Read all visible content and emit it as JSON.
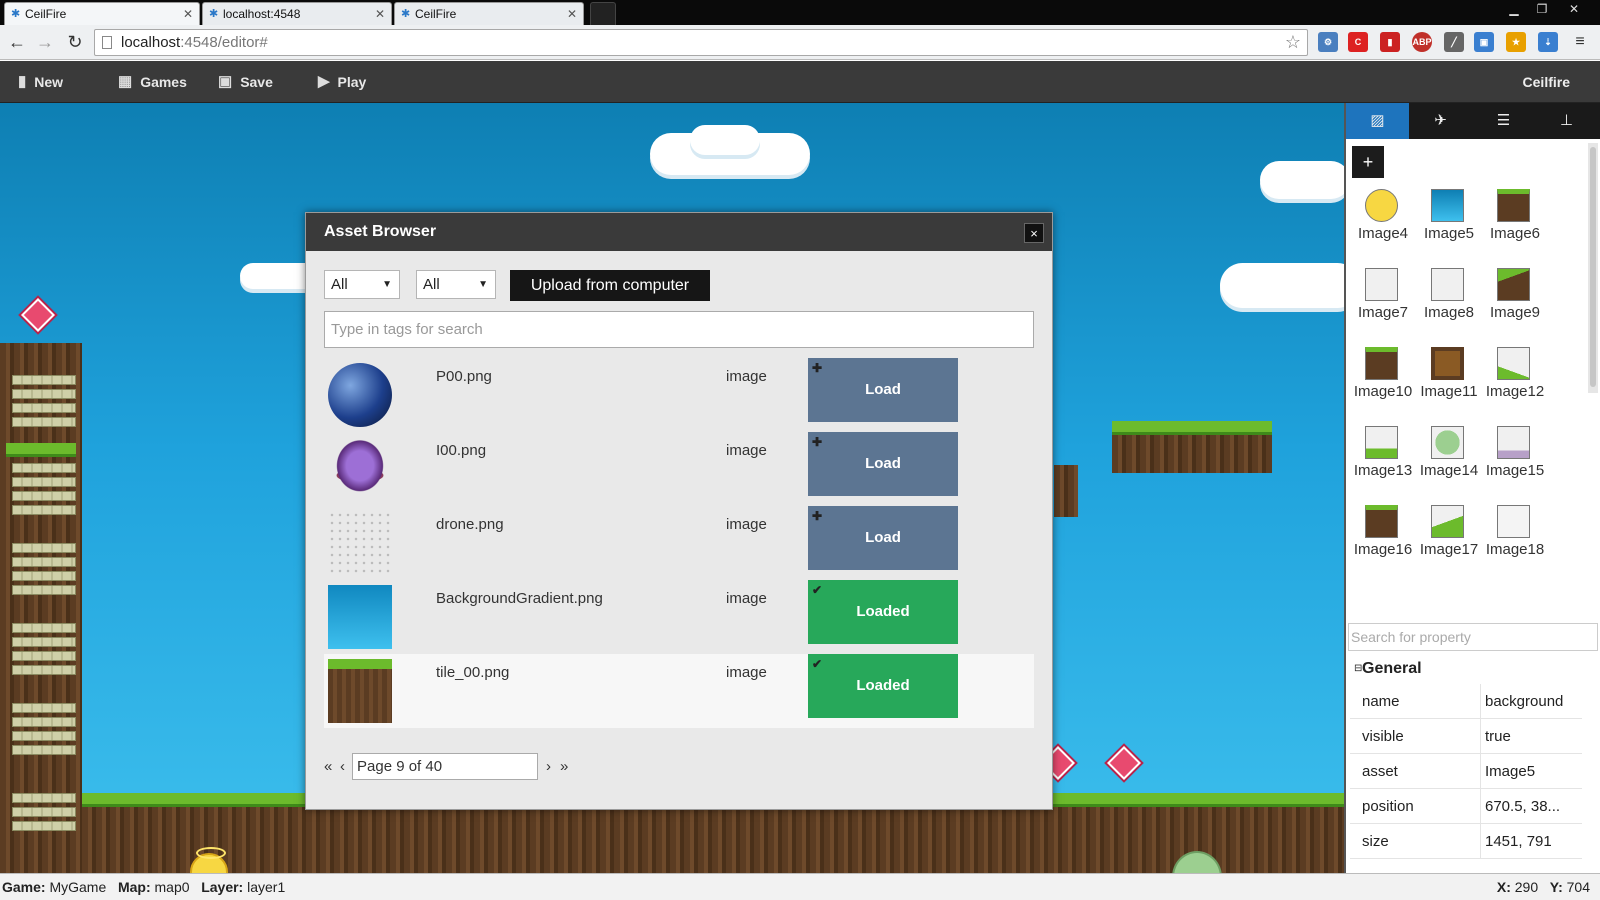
{
  "browser": {
    "tabs": [
      {
        "title": "CeilFire",
        "active": true
      },
      {
        "title": "localhost:4548",
        "active": false
      },
      {
        "title": "CeilFire",
        "active": false
      }
    ],
    "address": {
      "host": "localhost",
      "path": ":4548/editor#"
    }
  },
  "toolbar": {
    "new_label": "New",
    "games_label": "Games",
    "save_label": "Save",
    "play_label": "Play",
    "brand": "Ceilfire"
  },
  "dialog": {
    "title": "Asset Browser",
    "close_glyph": "×",
    "filter1": "All",
    "filter2": "All",
    "upload_label": "Upload from computer",
    "search_placeholder": "Type in tags for search",
    "assets": [
      {
        "name": "P00.png",
        "type": "image",
        "action": "Load",
        "state": "load"
      },
      {
        "name": "I00.png",
        "type": "image",
        "action": "Load",
        "state": "load"
      },
      {
        "name": "drone.png",
        "type": "image",
        "action": "Load",
        "state": "load"
      },
      {
        "name": "BackgroundGradient.png",
        "type": "image",
        "action": "Loaded",
        "state": "loaded"
      },
      {
        "name": "tile_00.png",
        "type": "image",
        "action": "Loaded",
        "state": "loaded"
      }
    ],
    "pager": {
      "first": "«",
      "prev": "‹",
      "page_text": "Page 9 of 40",
      "next": "›",
      "last": "»"
    }
  },
  "right_panel": {
    "tabs": [
      "image-icon",
      "plane-icon",
      "list-icon",
      "hierarchy-icon"
    ],
    "add_label": "+",
    "images": [
      "Image4",
      "Image5",
      "Image6",
      "Image7",
      "Image8",
      "Image9",
      "Image10",
      "Image11",
      "Image12",
      "Image13",
      "Image14",
      "Image15",
      "Image16",
      "Image17",
      "Image18"
    ],
    "property_search_placeholder": "Search for property",
    "general_header": "General",
    "general_toggle": "⊟",
    "properties": [
      {
        "key": "name",
        "value": "background"
      },
      {
        "key": "visible",
        "value": "true"
      },
      {
        "key": "asset",
        "value": "Image5"
      },
      {
        "key": "position",
        "value": "670.5, 38..."
      },
      {
        "key": "size",
        "value": "1451, 791"
      }
    ]
  },
  "status": {
    "game_label": "Game:",
    "game": "MyGame",
    "map_label": "Map:",
    "map": "map0",
    "layer_label": "Layer:",
    "layer": "layer1",
    "x_label": "X:",
    "x": "290",
    "y_label": "Y:",
    "y": "704"
  },
  "colors": {
    "accent": "#1e74bd",
    "load": "#5c7592",
    "loaded": "#27a85a",
    "toolbar": "#3a3a3a"
  }
}
